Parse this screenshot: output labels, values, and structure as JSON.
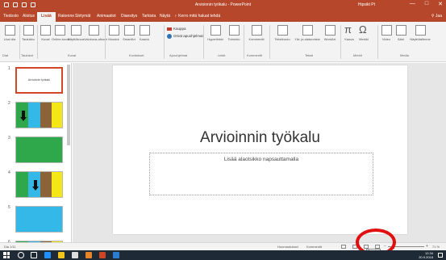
{
  "window": {
    "title": "Arvioinnin työkalu - PowerPoint",
    "user": "Hipsikt Pt",
    "buttons": [
      "—",
      "□",
      "✕"
    ]
  },
  "quick_access": [
    "save-icon",
    "undo-icon",
    "redo-icon",
    "start-from-beginning-icon"
  ],
  "tabs": [
    {
      "label": "Tiedosto"
    },
    {
      "label": "Aloitus"
    },
    {
      "label": "Lisää",
      "active": true
    },
    {
      "label": "Rakenne"
    },
    {
      "label": "Siirtymät"
    },
    {
      "label": "Animaatiot"
    },
    {
      "label": "Diaesitys"
    },
    {
      "label": "Tarkista"
    },
    {
      "label": "Näytä"
    },
    {
      "label": "♀ Kerro mitä haluat tehdä"
    }
  ],
  "share_label": "⚲ Jaa",
  "ribbon": {
    "buttons": [
      {
        "label": "Uusi dia"
      },
      {
        "label": "Taulukko"
      },
      {
        "label": "Kuvat"
      },
      {
        "label": "Online-kuvat"
      },
      {
        "label": "Näyttökuva"
      },
      {
        "label": "Valokuva-albumi"
      },
      {
        "label": "Muodot"
      },
      {
        "label": "SmartArt"
      },
      {
        "label": "Kaavio"
      },
      {
        "label": "Hyperlinkki"
      },
      {
        "label": "Toiminto"
      },
      {
        "label": "Kommentti"
      },
      {
        "label": "Tekstiruutu"
      },
      {
        "label": "Ylä- ja alatunniste"
      },
      {
        "label": "WordArt"
      },
      {
        "label": "Kaava"
      },
      {
        "label": "Merkki"
      },
      {
        "label": "Video"
      },
      {
        "label": "Ääni"
      },
      {
        "label": "Näyttötallenne"
      }
    ],
    "store": "Kauppa",
    "my_addins": "Omat apuohjelmat",
    "groups": [
      "Diat",
      "Taulukot",
      "Kuvat",
      "Kuvitukset",
      "Apuohjelmat",
      "Linkit",
      "Kommentit",
      "Teksti",
      "Merkit",
      "Media"
    ]
  },
  "thumbnails": {
    "numbers": [
      "1",
      "2",
      "3",
      "4",
      "5",
      "6"
    ],
    "slide1_text": "Arvioinnin työkalu"
  },
  "slide": {
    "title": "Arvioinnin työkalu",
    "subtitle_placeholder": "Lisää alaotsikko napsauttamalla"
  },
  "status": {
    "slide_counter": "Dia 1/11",
    "notes": "Huomautukset",
    "comments": "Kommentit",
    "zoom": "71 %",
    "tooltip": "Diaesitys"
  },
  "taskbar": {
    "time": "12.34",
    "date": "20.9.2018"
  },
  "colors": {
    "accent": "#b7472a",
    "highlight": "#e01010",
    "selected_border": "#d24726"
  }
}
